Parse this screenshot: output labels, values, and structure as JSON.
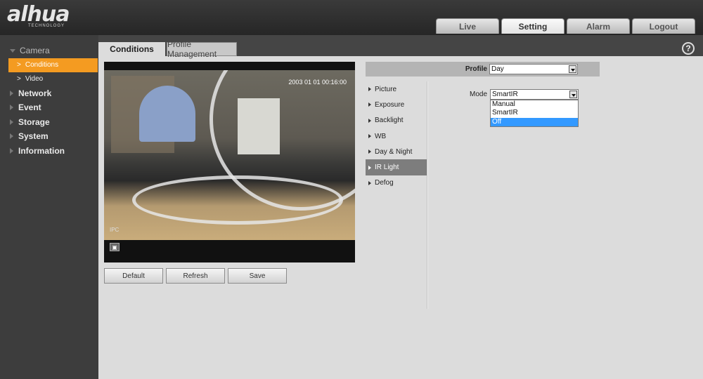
{
  "brand": {
    "logo_main": "alhua",
    "logo_sub": "TECHNOLOGY"
  },
  "top_tabs": [
    {
      "label": "Live",
      "active": false
    },
    {
      "label": "Setting",
      "active": true
    },
    {
      "label": "Alarm",
      "active": false
    },
    {
      "label": "Logout",
      "active": false
    }
  ],
  "sidebar": {
    "camera": "Camera",
    "camera_items": [
      "Conditions",
      "Video"
    ],
    "sections": [
      "Network",
      "Event",
      "Storage",
      "System",
      "Information"
    ]
  },
  "subtabs": {
    "active": "Conditions",
    "inactive": "Profile Management"
  },
  "help": "?",
  "video": {
    "timestamp": "2003 01 01 00:16:00",
    "channel_tag": "IPC"
  },
  "buttons": {
    "default": "Default",
    "refresh": "Refresh",
    "save": "Save"
  },
  "profile": {
    "label": "Profile",
    "value": "Day"
  },
  "settings_menu": [
    "Picture",
    "Exposure",
    "Backlight",
    "WB",
    "Day & Night",
    "IR Light",
    "Defog"
  ],
  "settings_menu_active": "IR Light",
  "mode": {
    "label": "Mode",
    "value": "SmartIR",
    "options": [
      "Manual",
      "SmartIR",
      "Off"
    ],
    "highlighted": "Off"
  },
  "colors": {
    "accent": "#f49b21",
    "highlight": "#3399ff",
    "sidebar_bg": "#3d3d3d"
  }
}
